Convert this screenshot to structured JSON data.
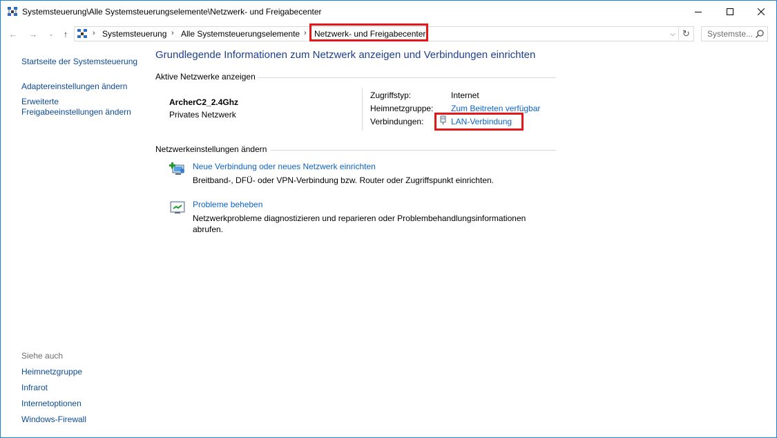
{
  "window": {
    "title": "Systemsteuerung\\Alle Systemsteuerungselemente\\Netzwerk- und Freigabecenter",
    "controls": {
      "minimize": "minimize-icon",
      "maximize": "maximize-icon",
      "close": "close-icon"
    }
  },
  "nav": {
    "breadcrumb": [
      "Systemsteuerung",
      "Alle Systemsteuerungselemente",
      "Netzwerk- und Freigabecenter"
    ],
    "search_placeholder": "Systemste..."
  },
  "sidebar": {
    "home": "Startseite der Systemsteuerung",
    "adapter": "Adaptereinstellungen ändern",
    "advanced_line1": "Erweiterte",
    "advanced_line2": "Freigabeeinstellungen ändern",
    "see_also_label": "Siehe auch",
    "see_also": [
      "Heimnetzgruppe",
      "Infrarot",
      "Internetoptionen",
      "Windows-Firewall"
    ]
  },
  "main": {
    "title": "Grundlegende Informationen zum Netzwerk anzeigen und Verbindungen einrichten",
    "active_networks_label": "Aktive Netzwerke anzeigen",
    "network": {
      "name": "ArcherC2_2.4Ghz",
      "type": "Privates Netzwerk",
      "access_type_label": "Zugriffstyp:",
      "access_type_value": "Internet",
      "homegroup_label": "Heimnetzgruppe:",
      "homegroup_value": "Zum Beitreten verfügbar",
      "connections_label": "Verbindungen:",
      "connections_value": "LAN-Verbindung"
    },
    "change_settings_label": "Netzwerkeinstellungen ändern",
    "tasks": [
      {
        "link": "Neue Verbindung oder neues Netzwerk einrichten",
        "desc": "Breitband-, DFÜ- oder VPN-Verbindung bzw. Router oder Zugriffspunkt einrichten."
      },
      {
        "link": "Probleme beheben",
        "desc": "Netzwerkprobleme diagnostizieren und reparieren oder Problembehandlungsinformationen abrufen."
      }
    ]
  },
  "colors": {
    "highlight_box": "#e3161a",
    "link": "#0c63c7",
    "title": "#1e3f8f",
    "window_border": "#1883d7"
  }
}
